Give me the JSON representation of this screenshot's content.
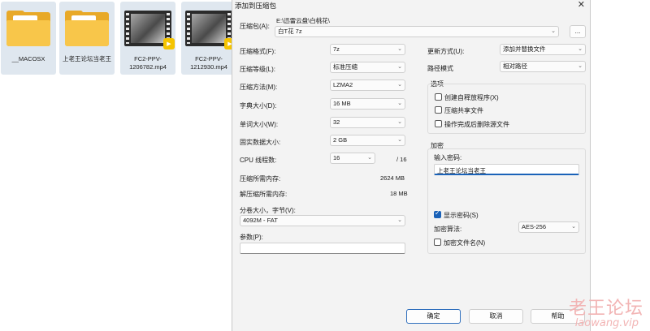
{
  "files": [
    {
      "name": "__MACOSX",
      "type": "folder"
    },
    {
      "name": "上老王论坛当老王",
      "type": "folder"
    },
    {
      "name": "FC2-PPV-1206782.mp4",
      "type": "video"
    },
    {
      "name": "FC2-PPV-1212930.mp4",
      "type": "video"
    }
  ],
  "dialog": {
    "title": "添加到压缩包",
    "close_glyph": "✕",
    "archive_label": "压缩包(A):",
    "archive_path": "E:\\迅雷云盘\\白桃花\\",
    "archive_name": "白T花 7z",
    "browse_label": "...",
    "format_label": "压缩格式(F):",
    "format_value": "7z",
    "level_label": "压缩等级(L):",
    "level_value": "标准压缩",
    "method_label": "压缩方法(M):",
    "method_value": "LZMA2",
    "dict_label": "字典大小(D):",
    "dict_value": "16 MB",
    "word_label": "单词大小(W):",
    "word_value": "32",
    "solid_label": "固实数据大小:",
    "solid_value": "2 GB",
    "threads_label": "CPU 线程数:",
    "threads_value": "16",
    "threads_total": "/ 16",
    "mem_comp_label": "压缩所需内存:",
    "mem_comp_value": "2624 MB",
    "mem_decomp_label": "解压缩所需内存:",
    "mem_decomp_value": "18 MB",
    "split_label": "分卷大小，字节(V):",
    "split_value": "4092M - FAT",
    "params_label": "参数(P):",
    "params_value": "",
    "update_label": "更新方式(U):",
    "update_value": "添加并替换文件",
    "pathmode_label": "路径模式",
    "pathmode_value": "相对路径",
    "options_title": "选项",
    "opt_sfx": "创建自释放程序(X)",
    "opt_shared": "压缩共享文件",
    "opt_delete": "操作完成后删除源文件",
    "encrypt_title": "加密",
    "password_label": "输入密码:",
    "password_value": "上老王论坛当老王",
    "show_password_label": "显示密码(S)",
    "show_password_checked": true,
    "enc_method_label": "加密算法:",
    "enc_method_value": "AES-256",
    "encrypt_names_label": "加密文件名(N)",
    "ok_label": "确定",
    "cancel_label": "取消",
    "help_label": "帮助"
  },
  "watermark": {
    "cn": "老王论坛",
    "url": "laowang.vip"
  }
}
